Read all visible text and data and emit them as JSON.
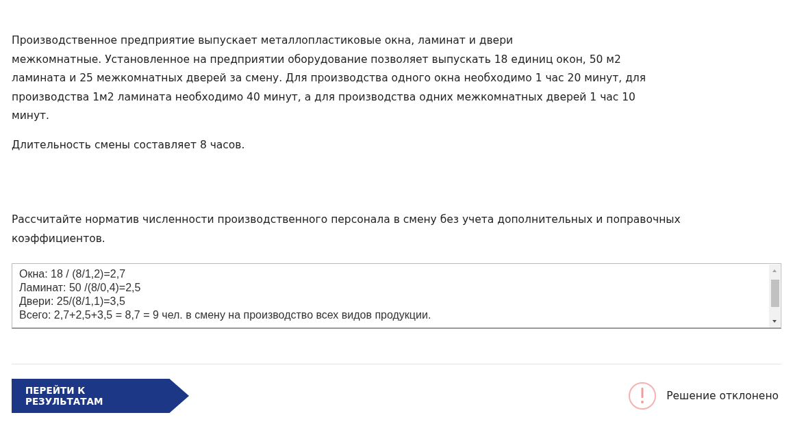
{
  "task": {
    "paragraphs": [
      {
        "lines": [
          "Производственное предприятие выпускает металлопластиковые окна, ламинат и двери",
          "межкомнатные. Установленное на предприятии оборудование позволяет выпускать 18 единиц окон, 50 м2 ламината и 25 межкомнатных дверей за смену. Для производства одного окна необходимо 1 час 20 минут, для производства 1м2 ламината необходимо 40 минут, а для производства одних межкомнатных дверей 1 час 10 минут."
        ]
      },
      {
        "lines": [
          "Длительность смены составляет 8 часов."
        ]
      }
    ],
    "question": "Рассчитайте норматив численности производственного персонала в смену без учета дополнительных и поправочных коэффициентов."
  },
  "answer": {
    "value": "Окна: 18 / (8/1,2)=2,7\nЛаминат: 50 /(8/0,4)=2,5\nДвери: 25/(8/1,1)=3,5\nВсего: 2,7+2,5+3,5 = 8,7 = 9 чел. в смену на производство всех видов продукции."
  },
  "results_button": {
    "label": "ПЕРЕЙТИ К РЕЗУЛЬТАТАМ"
  },
  "status": {
    "kind": "rejected",
    "text": "Решение отклонено"
  }
}
